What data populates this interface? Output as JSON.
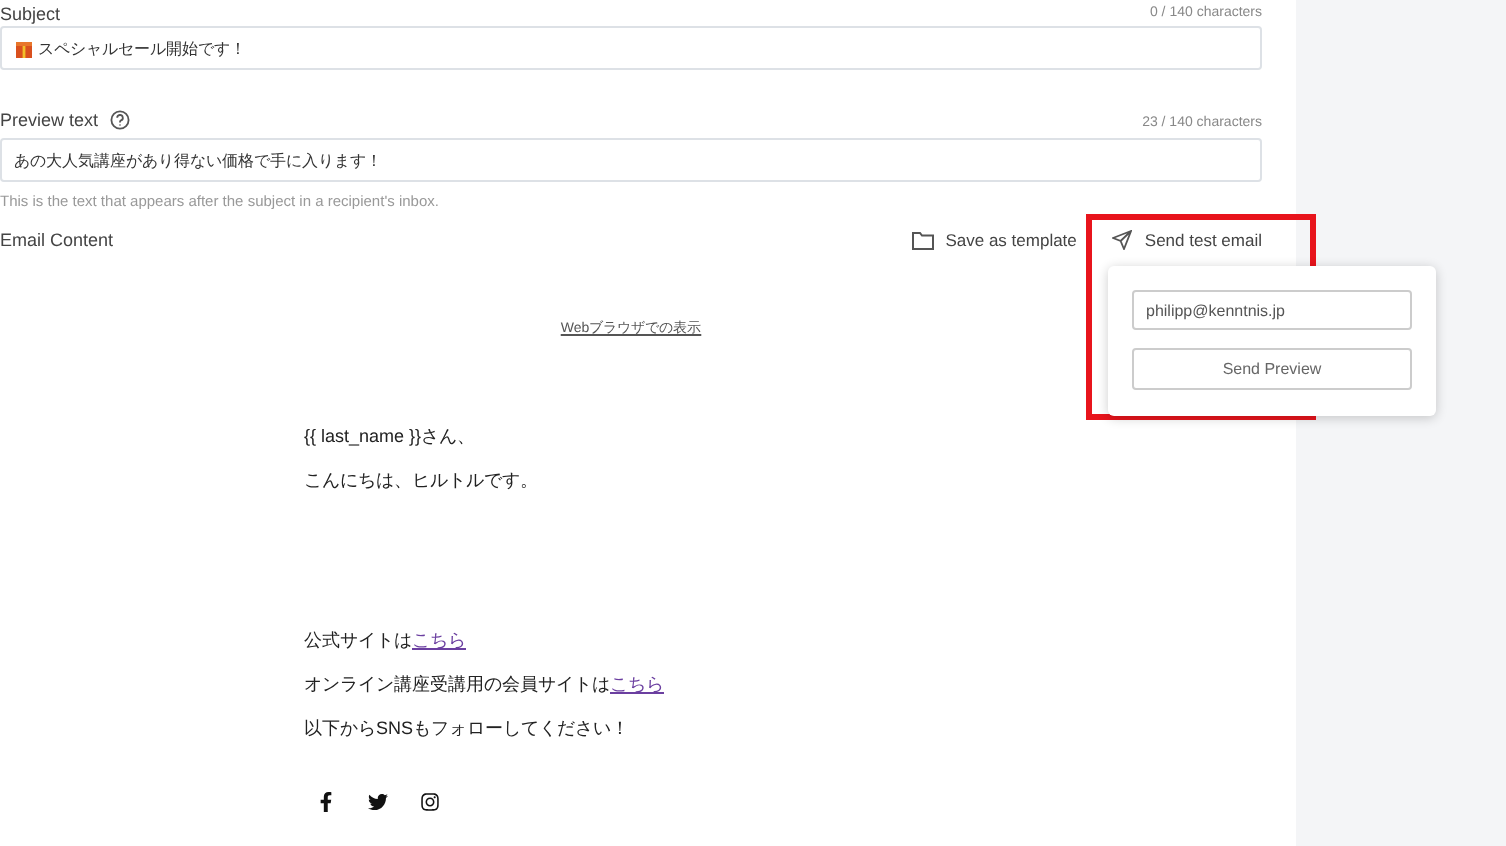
{
  "subject": {
    "label": "Subject",
    "counter": "0 / 140 characters",
    "value": "スペシャルセール開始です！"
  },
  "preview_text": {
    "label": "Preview text",
    "counter": "23 / 140 characters",
    "value": "あの大人気講座があり得ない価格で手に入ります！",
    "help": "This is the text that appears after the subject in a recipient's inbox."
  },
  "email_content": {
    "label": "Email Content",
    "actions": [
      {
        "kind": "folder",
        "label": "Save as template"
      },
      {
        "kind": "send",
        "label": "Send test email"
      }
    ]
  },
  "test_popover": {
    "email": "philipp@kenntnis.jp",
    "button": "Send Preview"
  },
  "email_body": {
    "web_link": "Webブラウザでの表示",
    "greeting": [
      "{{ last_name }}さん、",
      "こんにちは、ヒルトルです。"
    ],
    "lines": [
      {
        "text": "公式サイトは",
        "link": "こちら"
      },
      {
        "text": "オンライン講座受講用の会員サイトは",
        "link": "こちら"
      },
      {
        "text": " 以下からSNSもフォローしてください！"
      }
    ],
    "social": [
      {
        "kind": "facebook"
      },
      {
        "kind": "twitter"
      },
      {
        "kind": "instagram"
      }
    ]
  }
}
